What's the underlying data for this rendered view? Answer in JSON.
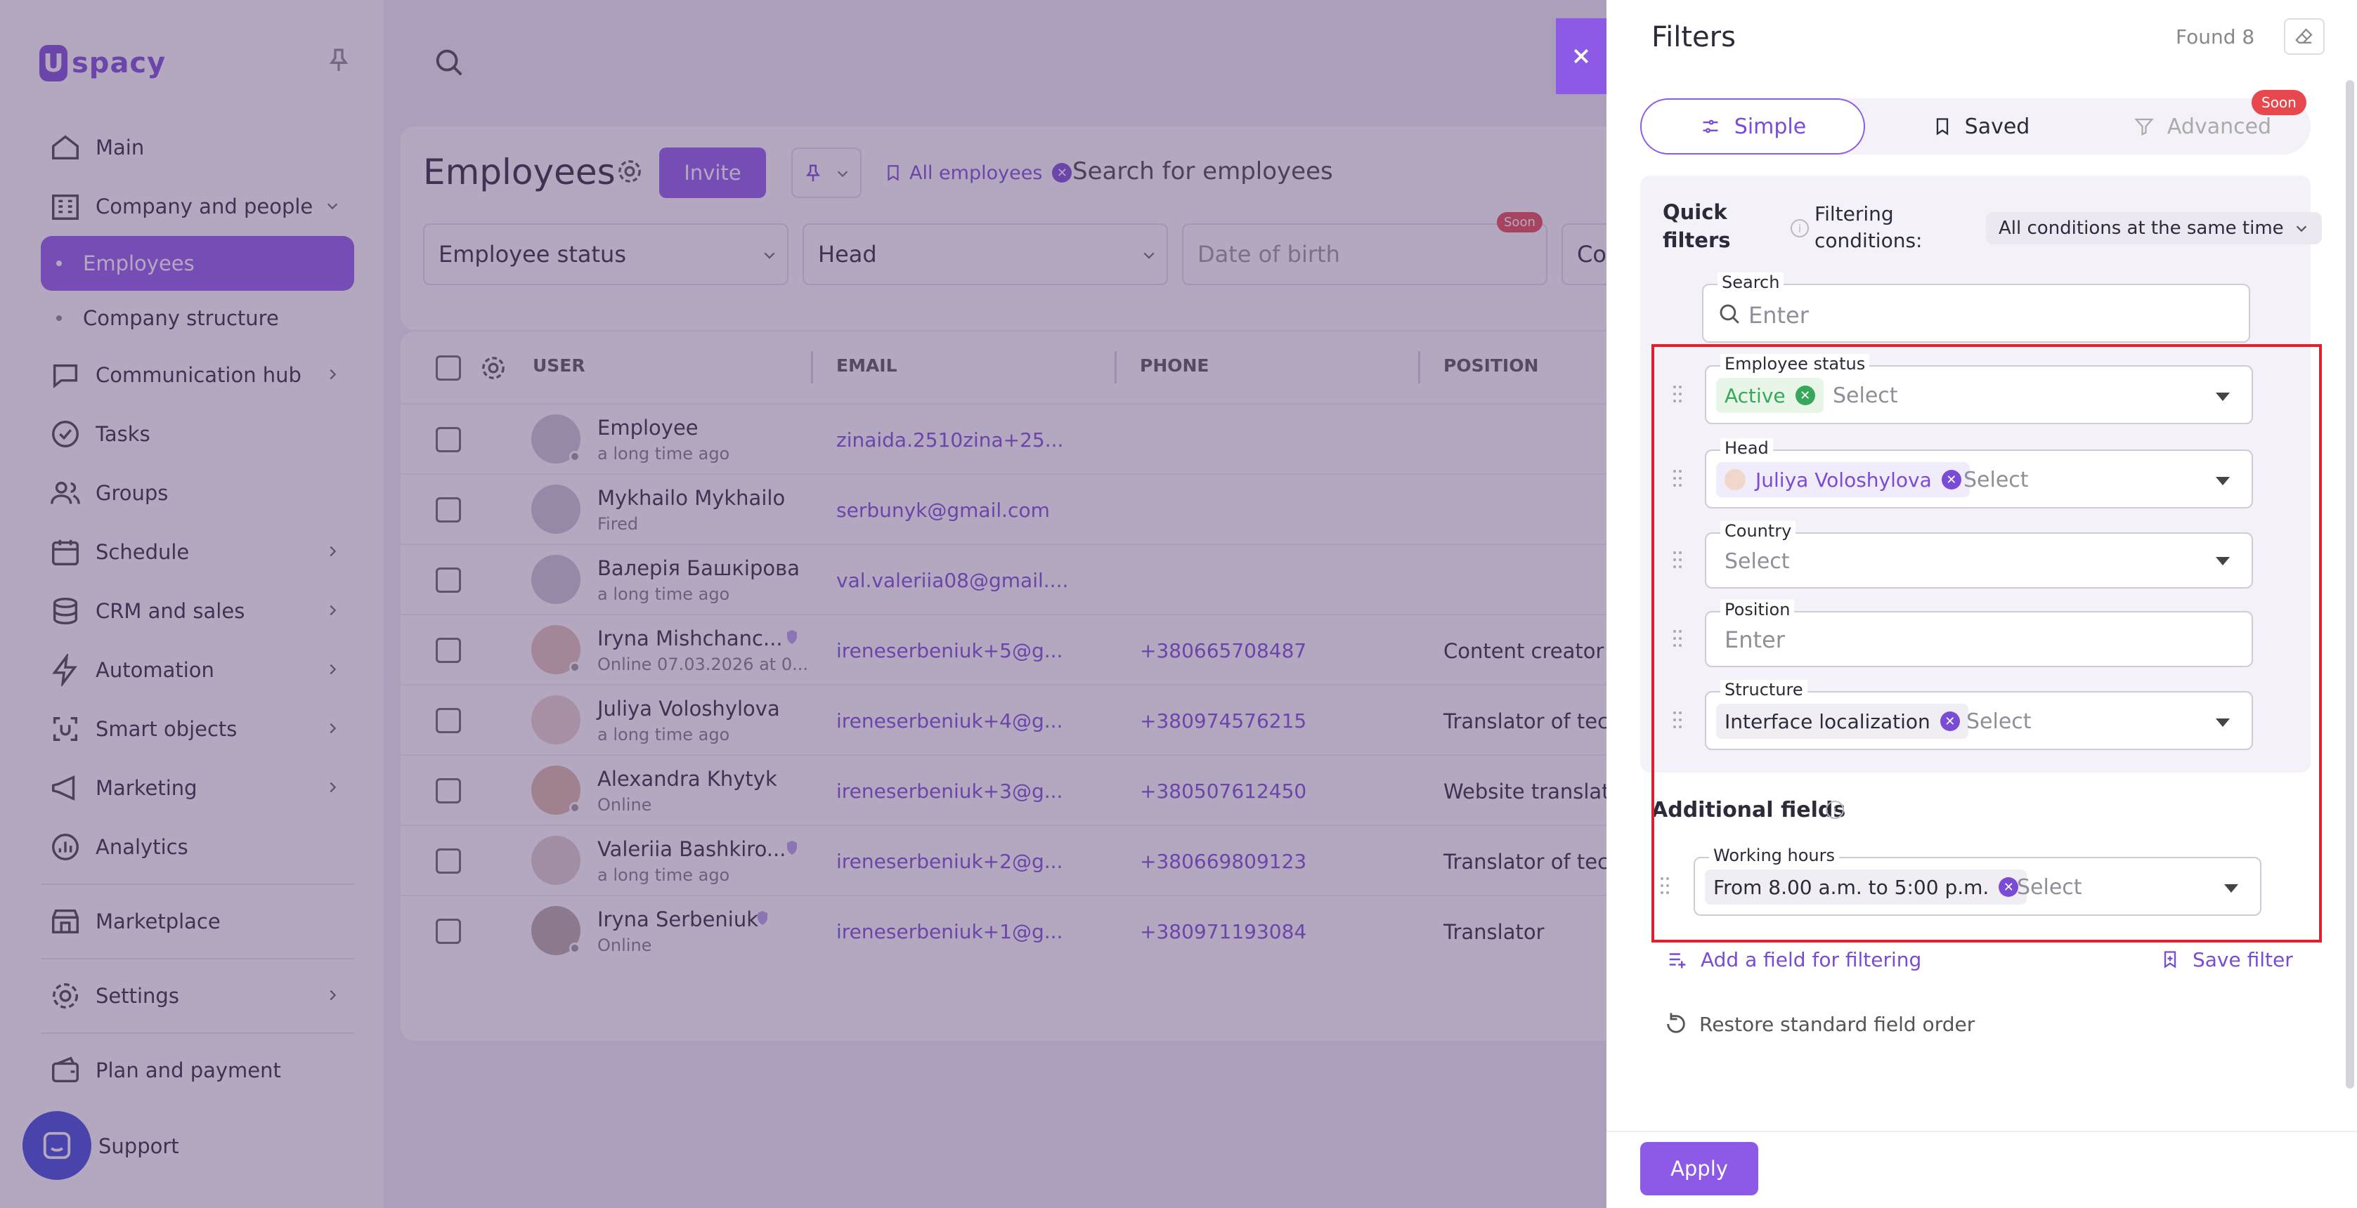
{
  "app": {
    "logo_letter": "U",
    "logo_text": "spacy"
  },
  "sidebar": {
    "items": [
      {
        "label": "Main"
      },
      {
        "label": "Company and people"
      },
      {
        "label": "Employees"
      },
      {
        "label": "Company structure"
      },
      {
        "label": "Communication hub"
      },
      {
        "label": "Tasks"
      },
      {
        "label": "Groups"
      },
      {
        "label": "Schedule"
      },
      {
        "label": "CRM and sales"
      },
      {
        "label": "Automation"
      },
      {
        "label": "Smart objects"
      },
      {
        "label": "Marketing"
      },
      {
        "label": "Analytics"
      },
      {
        "label": "Marketplace"
      },
      {
        "label": "Settings"
      },
      {
        "label": "Plan and payment"
      }
    ],
    "support": "Support"
  },
  "main": {
    "title": "Employees",
    "invite": "Invite",
    "all_employees": "All employees",
    "search_placeholder": "Search for employees",
    "filters": {
      "status": "Employee status",
      "head": "Head",
      "dob": "Date of birth",
      "co": "Co"
    },
    "soon": "Soon",
    "columns": {
      "user": "USER",
      "email": "EMAIL",
      "phone": "PHONE",
      "position": "POSITION"
    },
    "rows": [
      {
        "name": "Employee",
        "sub": "a long time ago",
        "email": "zinaida.2510zina+25...",
        "phone": "",
        "position": ""
      },
      {
        "name": "Mykhailo Mykhailo",
        "sub": "Fired",
        "email": "serbunyk@gmail.com",
        "phone": "",
        "position": ""
      },
      {
        "name": "Валерія Башкірова",
        "sub": "a long time ago",
        "email": "val.valeriia08@gmail....",
        "phone": "",
        "position": ""
      },
      {
        "name": "Iryna Mishchanc...",
        "sub": "Online 07.03.2026 at 0...",
        "email": "ireneserbeniuk+5@g...",
        "phone": "+380665708487",
        "position": "Content creator"
      },
      {
        "name": "Juliya Voloshylova",
        "sub": "a long time ago",
        "email": "ireneserbeniuk+4@g...",
        "phone": "+380974576215",
        "position": "Translator of tech"
      },
      {
        "name": "Alexandra Khytyk",
        "sub": "Online",
        "email": "ireneserbeniuk+3@g...",
        "phone": "+380507612450",
        "position": "Website translato"
      },
      {
        "name": "Valeriia Bashkiro...",
        "sub": "a long time ago",
        "email": "ireneserbeniuk+2@g...",
        "phone": "+380669809123",
        "position": "Translator of tech"
      },
      {
        "name": "Iryna Serbeniuk",
        "sub": "Online",
        "email": "ireneserbeniuk+1@g...",
        "phone": "+380971193084",
        "position": "Translator"
      }
    ]
  },
  "panel": {
    "title": "Filters",
    "found": "Found 8",
    "tabs": {
      "simple": "Simple",
      "saved": "Saved",
      "advanced": "Advanced"
    },
    "soon": "Soon",
    "quick_filters": "Quick filters",
    "filtering_conditions": "Filtering conditions:",
    "condition_value": "All conditions at the same time",
    "search": {
      "label": "Search",
      "placeholder": "Enter"
    },
    "employee_status": {
      "label": "Employee status",
      "chip": "Active",
      "placeholder": "Select"
    },
    "head": {
      "label": "Head",
      "chip": "Juliya Voloshylova",
      "placeholder": "Select"
    },
    "country": {
      "label": "Country",
      "placeholder": "Select"
    },
    "position": {
      "label": "Position",
      "placeholder": "Enter"
    },
    "structure": {
      "label": "Structure",
      "chip": "Interface localization",
      "placeholder": "Select"
    },
    "additional_fields": "Additional fields",
    "working_hours": {
      "label": "Working hours",
      "chip": "From 8.00 a.m. to 5:00 p.m.",
      "placeholder": "Select"
    },
    "add_field": "Add a field for filtering",
    "save_filter": "Save filter",
    "restore": "Restore standard field order",
    "apply": "Apply"
  },
  "colors": {
    "accent": "#8d5ae8",
    "highlight_box": "#e0202a",
    "active_green": "#37a85a",
    "soon_red": "#e6484d"
  }
}
